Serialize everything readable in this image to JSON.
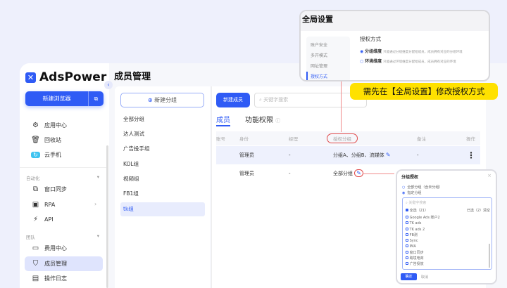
{
  "sidebar": {
    "brand": "AdsPower",
    "new_browser": "新建浏览器",
    "items": [
      "应用中心",
      "回收站",
      "云手机"
    ],
    "sections": [
      {
        "label": "自动化",
        "items": [
          "窗口同步",
          "RPA",
          "API"
        ]
      },
      {
        "label": "团队",
        "items": [
          "费用中心",
          "成员管理",
          "操作日志"
        ]
      }
    ]
  },
  "page_title": "成员管理",
  "groups": {
    "add": "新建分组",
    "items": [
      "全部分组",
      "达人测试",
      "广告投手组",
      "KOL组",
      "视频组",
      "FB1组",
      "tk组"
    ],
    "selected": "tk组"
  },
  "members": {
    "add": "新建成员",
    "search_placeholder": "关键字搜索",
    "tabs": [
      "成员",
      "功能权限"
    ],
    "columns": [
      "账号",
      "身份",
      "经理",
      "授权分组",
      "备注",
      "操作"
    ],
    "rows": [
      {
        "role": "管理员",
        "manager": "-",
        "groups": "分组A、分组B、流媒体",
        "note": "-"
      },
      {
        "role": "管理员",
        "manager": "-",
        "groups": "全部分组",
        "note": ""
      }
    ]
  },
  "global_settings": {
    "title": "全局设置",
    "menu": [
      "账户安全",
      "多开模式",
      "网址管理",
      "授权方式"
    ],
    "section": "授权方式",
    "options": [
      {
        "label": "分组维度",
        "desc": "只能通过分组维度分配给成员，成员拥有对应的分组环境",
        "checked": true
      },
      {
        "label": "环境维度",
        "desc": "只能通过环境维度分配给成员，成员拥有对应的环境",
        "checked": false
      }
    ]
  },
  "callout": "需先在【全局设置】修改授权方式",
  "dialog": {
    "title": "分组授权",
    "opt_all": "全部分组（含未分组）",
    "opt_custom": "指定分组",
    "search_placeholder": "关键字搜索",
    "select_all": "全选（21）",
    "selected": "已选（2）清空",
    "items": [
      "Google Ads 账户2",
      "TK ads",
      "TK ads 2",
      "FB测",
      "Sync",
      "IMA",
      "窗口同步",
      "跨境电商",
      "广告投放"
    ],
    "ok": "确定",
    "cancel": "取消"
  },
  "colors": {
    "primary": "#2f5bf5",
    "callout": "#ffe100",
    "annotation": "#e04a4a"
  }
}
